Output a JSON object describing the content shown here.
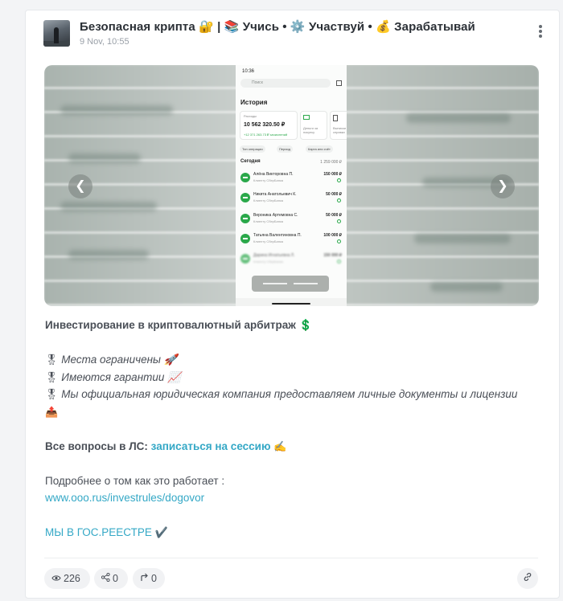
{
  "post": {
    "channel_title": "Безопасная крипта 🔐 | 📚 Учись • ⚙️ Участвуй • 💰 Зарабатывай",
    "timestamp": "9 Nov, 10:55",
    "avatar_icon": "channel-avatar",
    "menu_icon": "more-vertical-icon"
  },
  "media": {
    "prev_icon": "chevron-left-icon",
    "next_icon": "chevron-right-icon",
    "phone": {
      "status_time": "10:36",
      "search_placeholder": "Поиск",
      "heading": "История",
      "expenses_label": "Расходы",
      "expenses_amount": "10 562 320.50 ₽",
      "cashback_text": "+12 371 263.73 ₽ зачислений",
      "card2_label": "Деньги за покупку",
      "card3_label": "Выписки и справки",
      "filters": [
        "Тип операции",
        "Период",
        "Карта или счёт"
      ],
      "today_label": "Сегодня",
      "today_total": "1 259 000 ₽",
      "transactions": [
        {
          "name": "Алёна Викторовна П.",
          "sub": "Клиенту СберБанка",
          "amount": "150 000 ₽"
        },
        {
          "name": "Никита Анатольевич К.",
          "sub": "Клиенту СберБанка",
          "amount": "50 000 ₽"
        },
        {
          "name": "Вероника Артемовна С.",
          "sub": "Клиенту СберБанка",
          "amount": "50 000 ₽"
        },
        {
          "name": "Татьяна Валентиновна П.",
          "sub": "Клиенту СберБанка",
          "amount": "100 000 ₽"
        },
        {
          "name": "Дарина Игнатьевна Л.",
          "sub": "Клиенту СберБанка",
          "amount": "150 000 ₽"
        }
      ]
    }
  },
  "body": {
    "headline": "Инвестирование в криптовалютный арбитраж 💲",
    "bullet_icon": "🎖",
    "bullets": [
      "Места ограничены 🚀",
      "Имеются гарантии 📈",
      "Мы официальная юридическая компания предоставляем личные документы и лицензии"
    ],
    "bullet3_tail": "📤",
    "questions_label": "Все вопросы в ЛС: ",
    "session_link": "записаться на сессию",
    "session_emoji": "✍️",
    "more_label": "Подробнее о том как это работает :",
    "url": "www.ooo.rus/investrules/dogovor",
    "registry_link": "МЫ В ГОС.РЕЕСТРЕ",
    "registry_emoji": "✔️"
  },
  "footer": {
    "views": "226",
    "views_icon": "eye-icon",
    "shares": "0",
    "shares_icon": "share-icon",
    "forwards": "0",
    "forwards_icon": "forward-icon",
    "link_icon": "link-icon"
  },
  "colors": {
    "link": "#34a8c6",
    "text": "#4a4f57",
    "sber_green": "#2aa84a"
  }
}
